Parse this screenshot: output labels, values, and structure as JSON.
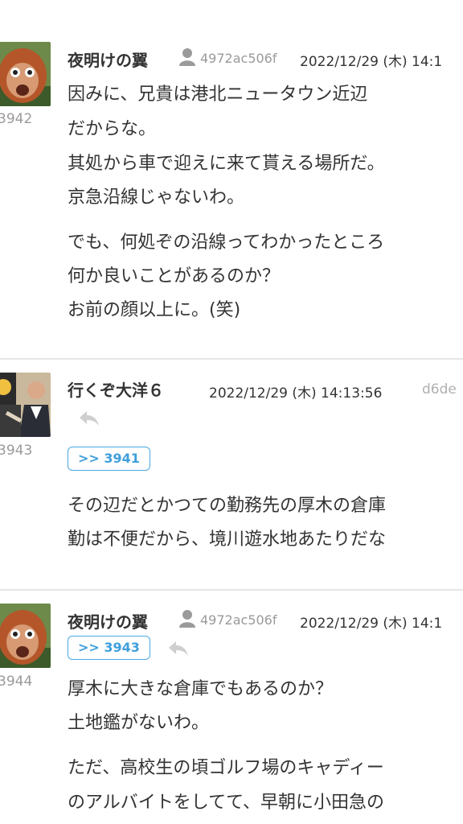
{
  "posts": [
    {
      "number": "3942",
      "name": "夜明けの翼",
      "uid": "4972ac506f",
      "date": "2022/12/29 (木) 14:1",
      "lines": [
        "因みに、兄貴は港北ニュータウン近辺",
        "だからな。",
        "其処から車で迎えに来て貰える場所だ。",
        "京急沿線じゃないわ。",
        "でも、何処ぞの沿線ってわかったところ",
        "何か良いことがあるのか？",
        "お前の顔以上に。(笑)"
      ]
    },
    {
      "number": "3943",
      "name": "行くぞ大洋６",
      "date": "2022/12/29 (木) 14:13:56",
      "trail": "d6de",
      "anchor": ">> 3941",
      "lines": [
        "その辺だとかつての勤務先の厚木の倉庫",
        "勤は不便だから、境川遊水地あたりだな"
      ]
    },
    {
      "number": "3944",
      "name": "夜明けの翼",
      "uid": "4972ac506f",
      "date": "2022/12/29 (木) 14:1",
      "anchor": ">> 3943",
      "lines": [
        "厚木に大きな倉庫でもあるのか？",
        "土地鑑がないわ。",
        "ただ、高校生の頃ゴルフ場のキャディー",
        "のアルバイトをしてて、早朝に小田急の"
      ]
    }
  ],
  "colors": {
    "accent": "#3f9fdb",
    "muted": "#9a9a9a",
    "text": "#333333"
  },
  "icons": {
    "user": "user-icon",
    "reply": "reply-icon"
  }
}
